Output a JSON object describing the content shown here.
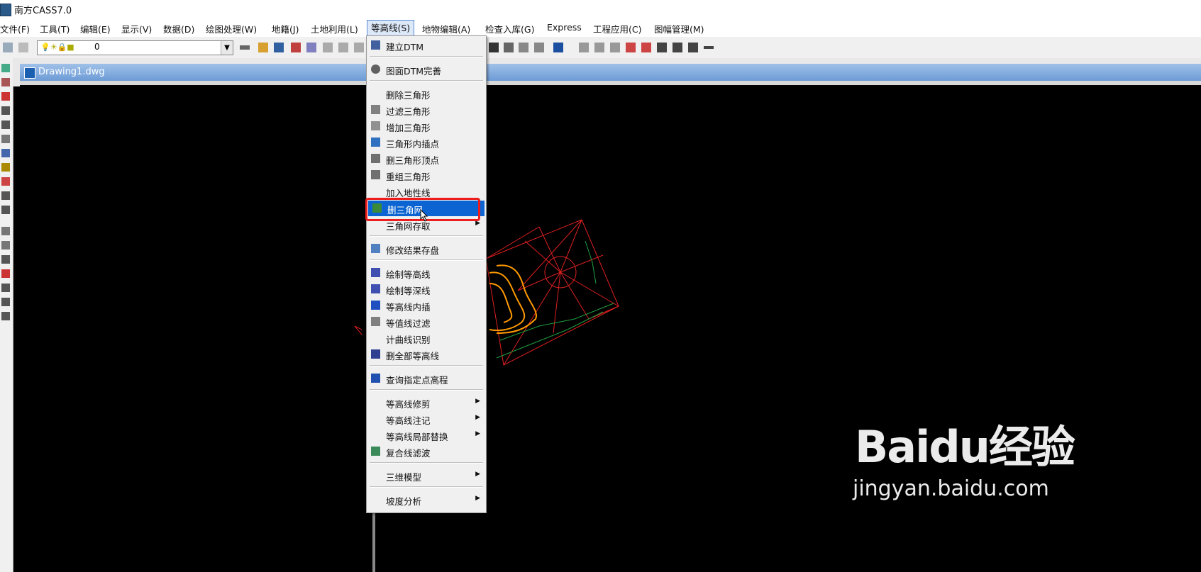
{
  "window": {
    "title": "南方CASS7.0"
  },
  "menubar": {
    "items": [
      "文件(F)",
      "工具(T)",
      "编辑(E)",
      "显示(V)",
      "数据(D)",
      "绘图处理(W)",
      "地籍(J)",
      "土地利用(L)",
      "等高线(S)",
      "地物编辑(A)",
      "检查入库(G)",
      "Express",
      "工程应用(C)",
      "图幅管理(M)"
    ]
  },
  "toolbar": {
    "layer_value": "0"
  },
  "document": {
    "tab_title": "Drawing1.dwg"
  },
  "dropdown": {
    "items": [
      {
        "label": "建立DTM",
        "icon": "dtm-icon"
      },
      {
        "label": "图面DTM完善",
        "icon": "dtm-refine-icon"
      },
      {
        "label": "删除三角形",
        "icon": ""
      },
      {
        "label": "过滤三角形",
        "icon": "filter-triangle-icon"
      },
      {
        "label": "增加三角形",
        "icon": "add-triangle-icon"
      },
      {
        "label": "三角形内插点",
        "icon": "interpolate-point-icon"
      },
      {
        "label": "删三角形顶点",
        "icon": "delete-vertex-icon"
      },
      {
        "label": "重组三角形",
        "icon": "rebuild-triangle-icon"
      },
      {
        "label": "加入地性线",
        "icon": ""
      },
      {
        "label": "删三角网",
        "icon": "delete-tin-icon"
      },
      {
        "label": "三角网存取",
        "icon": ""
      },
      {
        "label": "修改结果存盘",
        "icon": "save-result-icon"
      },
      {
        "label": "绘制等高线",
        "icon": "draw-contour-icon"
      },
      {
        "label": "绘制等深线",
        "icon": "draw-isobath-icon"
      },
      {
        "label": "等高线内插",
        "icon": "contour-interpolate-icon"
      },
      {
        "label": "等值线过滤",
        "icon": "contour-filter-icon"
      },
      {
        "label": "计曲线识别",
        "icon": ""
      },
      {
        "label": "删全部等高线",
        "icon": "delete-all-contours-icon"
      },
      {
        "label": "查询指定点高程",
        "icon": "query-elevation-icon"
      },
      {
        "label": "等高线修剪",
        "icon": ""
      },
      {
        "label": "等高线注记",
        "icon": ""
      },
      {
        "label": "等高线局部替换",
        "icon": ""
      },
      {
        "label": "复合线滤波",
        "icon": "polyline-filter-icon"
      },
      {
        "label": "三维模型",
        "icon": ""
      },
      {
        "label": "坡度分析",
        "icon": ""
      }
    ],
    "highlighted": "删三角网"
  },
  "watermark": {
    "logo": "Baidu经验",
    "url": "jingyan.baidu.com"
  }
}
